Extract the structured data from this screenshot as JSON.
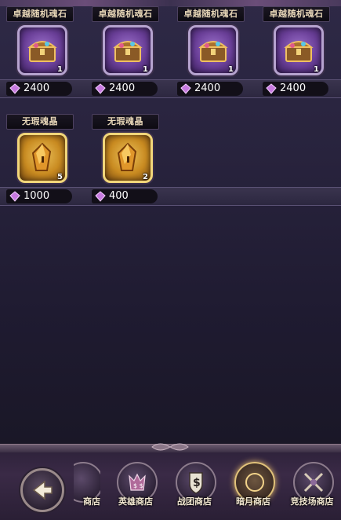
{
  "shop_row1": [
    {
      "name": "卓越随机魂石",
      "count": "1",
      "price": "2400",
      "icon": "treasure-chest-icon"
    },
    {
      "name": "卓越随机魂石",
      "count": "1",
      "price": "2400",
      "icon": "treasure-chest-icon"
    },
    {
      "name": "卓越随机魂石",
      "count": "1",
      "price": "2400",
      "icon": "treasure-chest-icon"
    },
    {
      "name": "卓越随机魂石",
      "count": "1",
      "price": "2400",
      "icon": "treasure-chest-icon"
    }
  ],
  "shop_row2": [
    {
      "name": "无瑕魂晶",
      "count": "5",
      "price": "1000",
      "icon": "soul-crystal-icon"
    },
    {
      "name": "无瑕魂晶",
      "count": "2",
      "price": "400",
      "icon": "soul-crystal-icon"
    }
  ],
  "currency_icon": "purple-gem-icon",
  "bottom_nav": {
    "back_icon": "back-arrow-icon",
    "tabs": [
      {
        "label": "商店",
        "icon": "shop-icon"
      },
      {
        "label": "英雄商店",
        "icon": "hero-shop-icon"
      },
      {
        "label": "战团商店",
        "icon": "guild-shop-icon"
      },
      {
        "label": "暗月商店",
        "icon": "dark-moon-shop-icon"
      },
      {
        "label": "竞技场商店",
        "icon": "arena-shop-icon"
      }
    ]
  },
  "colors": {
    "accent_gold": "#e1c27a",
    "gem_purple": "#c77ae0"
  }
}
